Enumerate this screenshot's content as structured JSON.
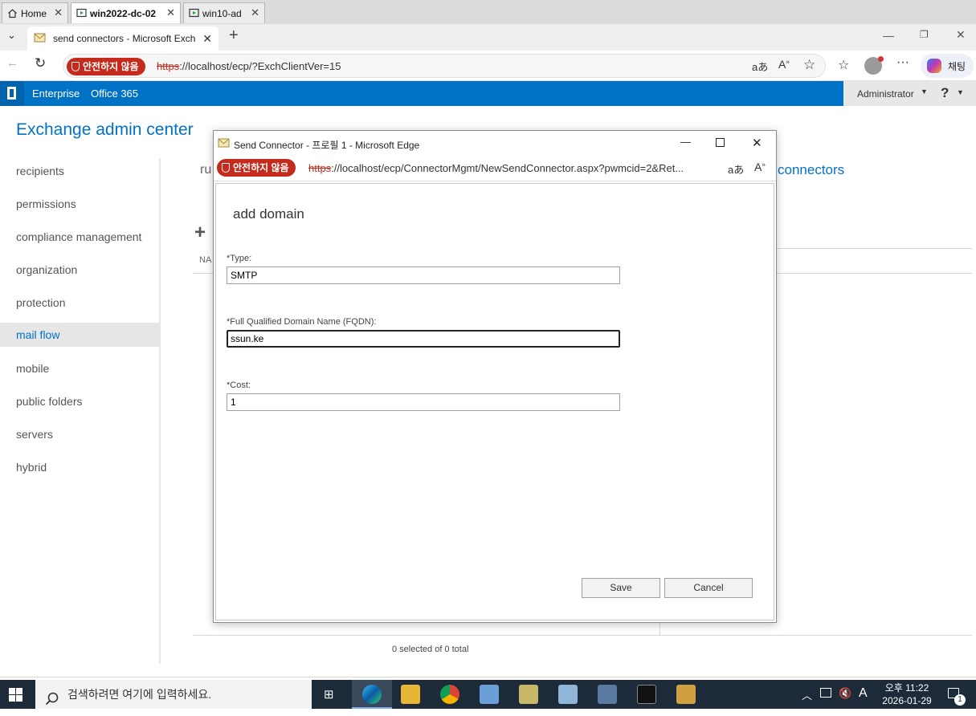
{
  "vm_tabs": [
    {
      "label": "Home"
    },
    {
      "label": "win2022-dc-02"
    },
    {
      "label": "win10-ad"
    }
  ],
  "browser": {
    "tab_title": "send connectors - Microsoft Exch",
    "security_label": "안전하지 않음",
    "url_scheme": "https",
    "url_rest": "://localhost/ecp/?ExchClientVer=15",
    "chat_label": "채팅"
  },
  "o365": {
    "enterprise": "Enterprise",
    "office365": "Office 365",
    "user": "Administrator",
    "help": "?"
  },
  "eac": {
    "title": "Exchange admin center",
    "nav": [
      {
        "label": "recipients"
      },
      {
        "label": "permissions"
      },
      {
        "label": "compliance management"
      },
      {
        "label": "organization"
      },
      {
        "label": "protection"
      },
      {
        "label": "mail flow"
      },
      {
        "label": "mobile"
      },
      {
        "label": "public folders"
      },
      {
        "label": "servers"
      },
      {
        "label": "hybrid"
      }
    ],
    "subtab_partial": "ru",
    "subtab_connectors": "connectors",
    "col_partial": "NA",
    "status": "0 selected of 0 total"
  },
  "dialog": {
    "title": "Send Connector - 프로필 1 - Microsoft Edge",
    "security_label": "안전하지 않음",
    "url_scheme": "https",
    "url_rest": "://localhost/ecp/ConnectorMgmt/NewSendConnector.aspx?pwmcid=2&Ret...",
    "heading": "add domain",
    "type_label": "*Type:",
    "type_value": "SMTP",
    "fqdn_label": "*Full Qualified Domain Name (FQDN):",
    "fqdn_value": "ssun.ke",
    "cost_label": "*Cost:",
    "cost_value": "1",
    "save": "Save",
    "cancel": "Cancel"
  },
  "taskbar": {
    "search_placeholder": "검색하려면 여기에 입력하세요.",
    "ime": "A",
    "time": "오후 11:22",
    "date": "2026-01-29",
    "notification_count": "1"
  }
}
